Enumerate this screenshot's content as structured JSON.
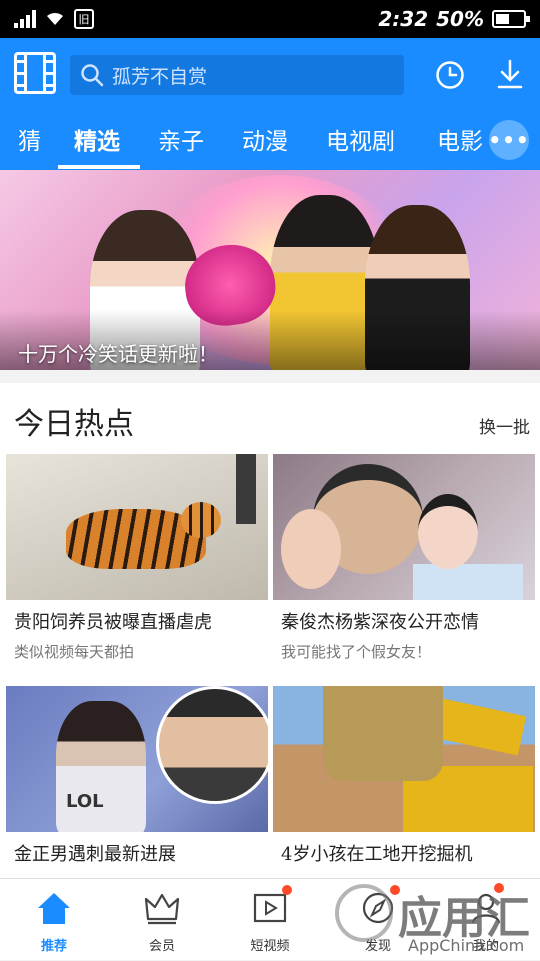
{
  "status_bar": {
    "time": "2:32",
    "battery_percent": "50%",
    "battery_level": 0.5,
    "sim_label": "旧"
  },
  "header": {
    "search_placeholder": "孤芳不自赏",
    "tabs": [
      {
        "label": "猜"
      },
      {
        "label": "精选"
      },
      {
        "label": "亲子"
      },
      {
        "label": "动漫"
      },
      {
        "label": "电视剧"
      },
      {
        "label": "电影"
      }
    ],
    "active_tab": "精选",
    "more_label": "•••"
  },
  "banner": {
    "caption": "十万个冷笑话更新啦！"
  },
  "hot_section": {
    "title": "今日热点",
    "refresh_label": "换一批",
    "cards": [
      {
        "title": "贵阳饲养员被曝直播虐虎",
        "subtitle": "类似视频每天都拍"
      },
      {
        "title": "秦俊杰杨紫深夜公开恋情",
        "subtitle": "我可能找了个假女友！"
      },
      {
        "title": "金正男遇刺最新进展",
        "subtitle": "",
        "thumb_text": "LOL"
      },
      {
        "title": "4岁小孩在工地开挖掘机",
        "subtitle": ""
      }
    ]
  },
  "bottom_nav": {
    "items": [
      {
        "label": "推荐",
        "icon": "home-icon"
      },
      {
        "label": "会员",
        "icon": "crown-icon"
      },
      {
        "label": "短视频",
        "icon": "play-icon"
      },
      {
        "label": "发现",
        "icon": "discover-icon"
      },
      {
        "label": "我的",
        "icon": "profile-icon"
      }
    ],
    "active": "推荐"
  },
  "watermark": {
    "text": "应用汇",
    "url": "AppChina.com"
  },
  "colors": {
    "brand_blue": "#1a8cff",
    "badge_red": "#ff4a2a"
  }
}
